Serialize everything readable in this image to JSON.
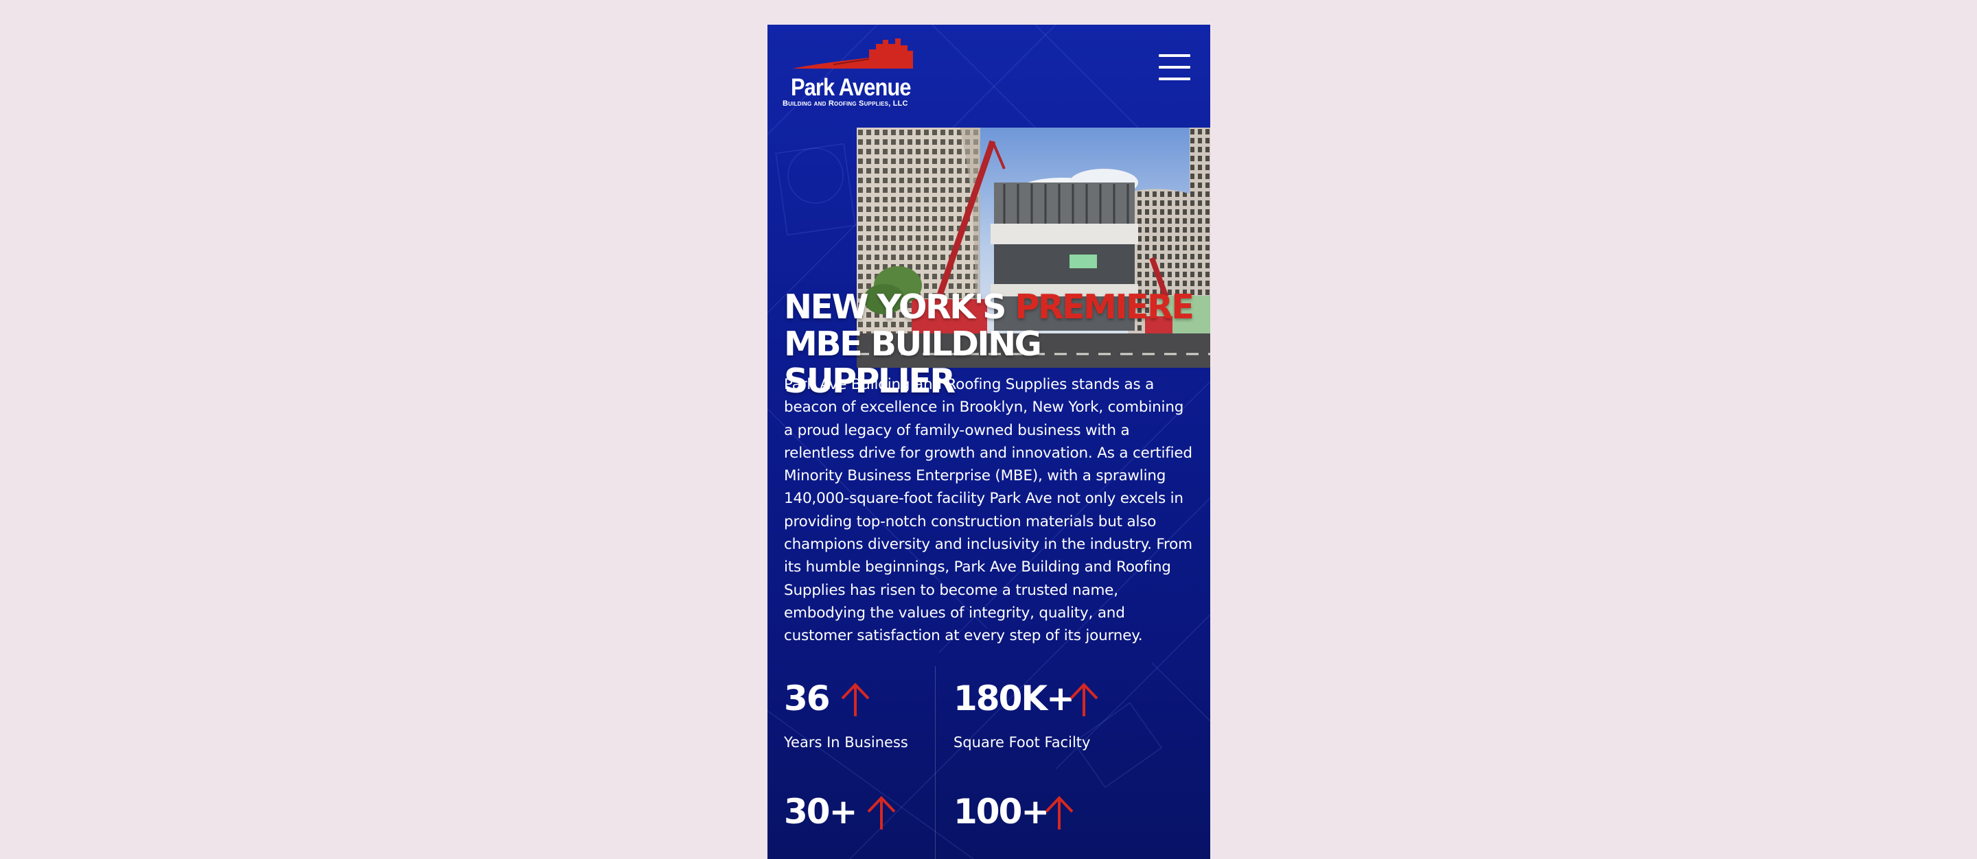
{
  "brand": {
    "name": "Park Avenue",
    "tagline": "Building and Roofing Supplies, LLC"
  },
  "hero": {
    "headline_part1": "NEW YORK'S ",
    "headline_accent": "PREMIERE",
    "headline_part2": "MBE BUILDING SUPPLIER",
    "body": "Park Ave Building and Roofing Supplies stands as a beacon of excellence in Brooklyn, New York, combining a proud legacy of family-owned business with a relentless drive for growth and innovation. As a certified Minority Business Enterprise (MBE), with a sprawling 140,000-square-foot facility Park Ave not only excels in providing top-notch construction materials but also champions diversity and inclusivity in the industry. From its humble beginnings, Park Ave Building and Roofing Supplies has risen to become a trusted name, embodying the values of integrity, quality, and customer satisfaction at every step of its journey."
  },
  "stats": [
    {
      "value": "36",
      "label": "Years In Business"
    },
    {
      "value": "180K+",
      "label": "Square Foot Facilty"
    },
    {
      "value": "30+",
      "label": ""
    },
    {
      "value": "100+",
      "label": ""
    }
  ],
  "icons": {
    "menu": "hamburger-menu-icon",
    "stat_arrow": "arrow-up-icon"
  },
  "colors": {
    "page_background": "#efe4ea",
    "panel_blue": "#0c1c92",
    "accent_red": "#d62820",
    "text": "#ffffff"
  }
}
